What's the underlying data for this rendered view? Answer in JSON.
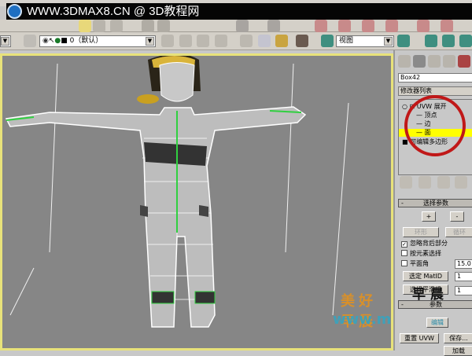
{
  "watermark": {
    "site": "WWW.3DMAX8.CN @ 3D教程网",
    "overlay_cn": "美好早晨",
    "overlay_url": "www.mhzc.cn",
    "stamp": "早晨"
  },
  "toolbar": {
    "layer_dropdown": "0（默认）",
    "view_dropdown": "视图",
    "icons": [
      "layers-icon",
      "eye-icon",
      "cursor-icon",
      "teapot-icon",
      "select-icon",
      "move-icon",
      "rotate-icon",
      "scale-icon",
      "layer-manager-icon",
      "schematic-icon",
      "curve-editor-icon",
      "material-icon",
      "render-icon",
      "quick-render-icon"
    ]
  },
  "panel": {
    "tabs": [
      "create-icon",
      "modify-icon",
      "hierarchy-icon",
      "motion-icon",
      "display-icon"
    ],
    "object_name": "Box42",
    "modifier_list": "修改器列表",
    "stack": [
      {
        "label": "UVW 展开",
        "level": 0,
        "expand": "⊟"
      },
      {
        "label": "顶点",
        "level": 1
      },
      {
        "label": "边",
        "level": 1
      },
      {
        "label": "面",
        "level": 1,
        "selected": true
      },
      {
        "label": "可编辑多边形",
        "level": 0,
        "expand": "■"
      }
    ],
    "highlight_color": "#ffff00",
    "circle_color": "#c01818",
    "selection_rollout": {
      "title": "选择参数",
      "plus": "+",
      "minus": "-",
      "ring": "环形",
      "loop": "循环",
      "ignore_backfacing": {
        "label": "忽略背后部分",
        "checked": true
      },
      "by_element": {
        "label": "按元素选择",
        "checked": false
      },
      "planar_angle": {
        "label": "平面角",
        "checked": false,
        "value": "15.0"
      },
      "select_matid": {
        "label": "选定 MatID",
        "value": "1"
      },
      "select_smoothing": {
        "label": "选择平滑组",
        "value": "1"
      }
    },
    "params_rollout": {
      "title": "参数",
      "edit": "编辑",
      "reset": "重置 UVW",
      "save": "保存...",
      "load": "加载"
    }
  }
}
